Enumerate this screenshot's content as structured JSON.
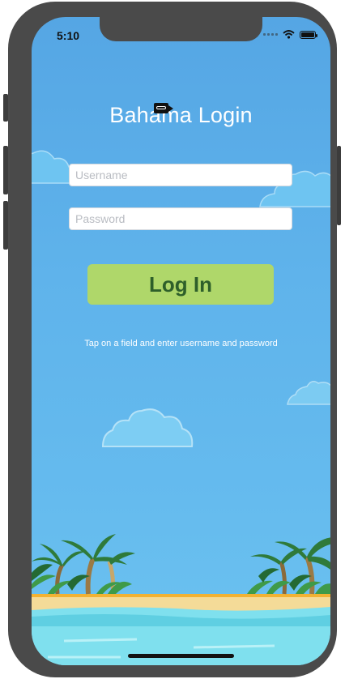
{
  "status_bar": {
    "time": "5:10"
  },
  "login": {
    "title": "Bahama Login",
    "username_placeholder": "Username",
    "password_placeholder": "Password",
    "login_button_label": "Log In",
    "hint": "Tap on a field and enter username and password"
  },
  "colors": {
    "sky_top": "#55a6e4",
    "sky_bottom": "#6cc3f0",
    "login_button": "#afd76a",
    "login_button_text": "#2e5f2a",
    "sand": "#f5dc9a",
    "water": "#7fe0ee"
  },
  "icons": {
    "status": [
      "signal-icon",
      "wifi-icon",
      "battery-icon"
    ],
    "overlay": "screen-recorder-icon"
  }
}
